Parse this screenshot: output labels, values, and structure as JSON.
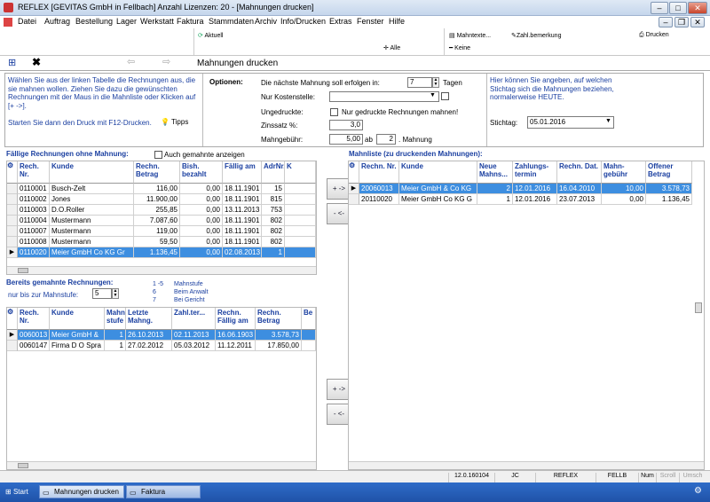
{
  "window": {
    "title": "REFLEX [GEVITAS GmbH in Fellbach] Anzahl Lizenzen: 20 - [Mahnungen drucken]"
  },
  "menu": [
    "Datei",
    "Auftrag",
    "Bestellung",
    "Lager",
    "Werkstatt",
    "Faktura",
    "Stammdaten",
    "Archiv",
    "Info/Drucken",
    "Extras",
    "Fenster",
    "Hilfe"
  ],
  "toolbar": {
    "aktuell": "Aktuell",
    "alle": "Alle",
    "mahntexte": "Mahntexte...",
    "keine": "Keine",
    "zahlbemerkung": "Zahl.bemerkung",
    "drucken": "Drucken"
  },
  "nav": {
    "title": "Mahnungen drucken"
  },
  "help": {
    "text": "Wählen Sie aus der linken Tabelle die Rechnungen aus, die sie mahnen wollen. Ziehen Sie dazu die gewünschten Rechnungen mit der Maus in die Mahnliste oder Klicken auf [+ ->].",
    "print_hint": "Starten Sie dann den Druck mit F12-Drucken.",
    "tipps": "Tipps"
  },
  "options": {
    "heading": "Optionen:",
    "next_label": "Die nächste Mahnung soll erfolgen in:",
    "next_value": "7",
    "next_unit": "Tagen",
    "cost_label": "Nur Kostenstelle:",
    "cost_value": "",
    "unprinted_label": "Ungedruckte:",
    "unprinted_check": "Nur gedruckte Rechnungen mahnen!",
    "interest_label": "Zinssatz %:",
    "interest_value": "3,0",
    "fee_label": "Mahngebühr:",
    "fee_value": "5,00",
    "fee_from": "ab",
    "fee_level": "2",
    "fee_unit": ". Mahnung"
  },
  "stichtag": {
    "text": "Hier können Sie angeben, auf welchen Stichtag sich die Mahnungen beziehen, normalerweise HEUTE.",
    "label": "Stichtag:",
    "value": "05.01.2016"
  },
  "due": {
    "heading": "Fällige Rechnungen ohne Mahnung:",
    "also_label": "Auch gemahnte anzeigen",
    "columns": [
      "Rech. Nr.",
      "Kunde",
      "Rechn. Betrag",
      "Bish. bezahlt",
      "Fällig am",
      "AdrNr.",
      "K"
    ],
    "rows": [
      [
        "0110001",
        "Busch-Zelt",
        "116,00",
        "0,00",
        "18.11.1901",
        "15",
        ""
      ],
      [
        "0110002",
        "Jones",
        "11.900,00",
        "0,00",
        "18.11.1901",
        "815",
        ""
      ],
      [
        "0110003",
        "D.O.Roller",
        "255,85",
        "0,00",
        "13.11.2013",
        "753",
        ""
      ],
      [
        "0110004",
        "Mustermann",
        "7.087,60",
        "0,00",
        "18.11.1901",
        "802",
        ""
      ],
      [
        "0110007",
        "Mustermann",
        "119,00",
        "0,00",
        "18.11.1901",
        "802",
        ""
      ],
      [
        "0110008",
        "Mustermann",
        "59,50",
        "0,00",
        "18.11.1901",
        "802",
        ""
      ],
      [
        "0110020",
        "Meier GmbH  Co KG Gr",
        "1.136,45",
        "0,00",
        "02.08.2013",
        "1",
        ""
      ]
    ]
  },
  "dunned": {
    "heading": "Bereits gemahnte Rechnungen:",
    "until_label": "nur bis zur Mahnstufe:",
    "until_value": "5",
    "legend": [
      [
        "1 -5",
        "Mahnstufe"
      ],
      [
        "6",
        "Beim Anwalt"
      ],
      [
        "7",
        "Bei Gericht"
      ]
    ],
    "columns": [
      "Rech. Nr.",
      "Kunde",
      "Mahn stufe",
      "Letzte Mahng.",
      "Zahl.ter...",
      "Rechn. Fällig am",
      "Rechn. Betrag",
      "Be"
    ],
    "rows": [
      [
        "0060013",
        "Meier GmbH &",
        "1",
        "26.10.2013",
        "02.11.2013",
        "16.06.1903",
        "3.578,73",
        ""
      ],
      [
        "0060147",
        "Firma D O Spra",
        "1",
        "27.02.2012",
        "05.03.2012",
        "11.12.2011",
        "17.850,00",
        ""
      ]
    ]
  },
  "mahnliste": {
    "heading": "Mahnliste (zu druckenden Mahnungen):",
    "columns": [
      "Rechn. Nr.",
      "Kunde",
      "Neue Mahns...",
      "Zahlungs- termin",
      "Rechn. Dat.",
      "Mahn- gebühr",
      "Offener Betrag"
    ],
    "rows": [
      [
        "20060013",
        "Meier GmbH & Co KG",
        "2",
        "12.01.2016",
        "16.04.2010",
        "10,00",
        "3.578,73"
      ],
      [
        "20110020",
        "Meier GmbH  Co KG G",
        "1",
        "12.01.2016",
        "23.07.2013",
        "0,00",
        "1.136,45"
      ]
    ]
  },
  "buttons": {
    "add": "+ ->",
    "remove": "- <-"
  },
  "status": [
    "12.0.160104",
    "JC",
    "REFLEX",
    "FELLB",
    "Num",
    "Scroll",
    "Umsch"
  ],
  "taskbar": {
    "start": "Start",
    "task1": "Mahnungen drucken",
    "task2": "Faktura"
  },
  "colors": {
    "selection": "#3d8ee0",
    "header_text": "#1a3fa0",
    "taskbar": "#2f6cc8"
  }
}
